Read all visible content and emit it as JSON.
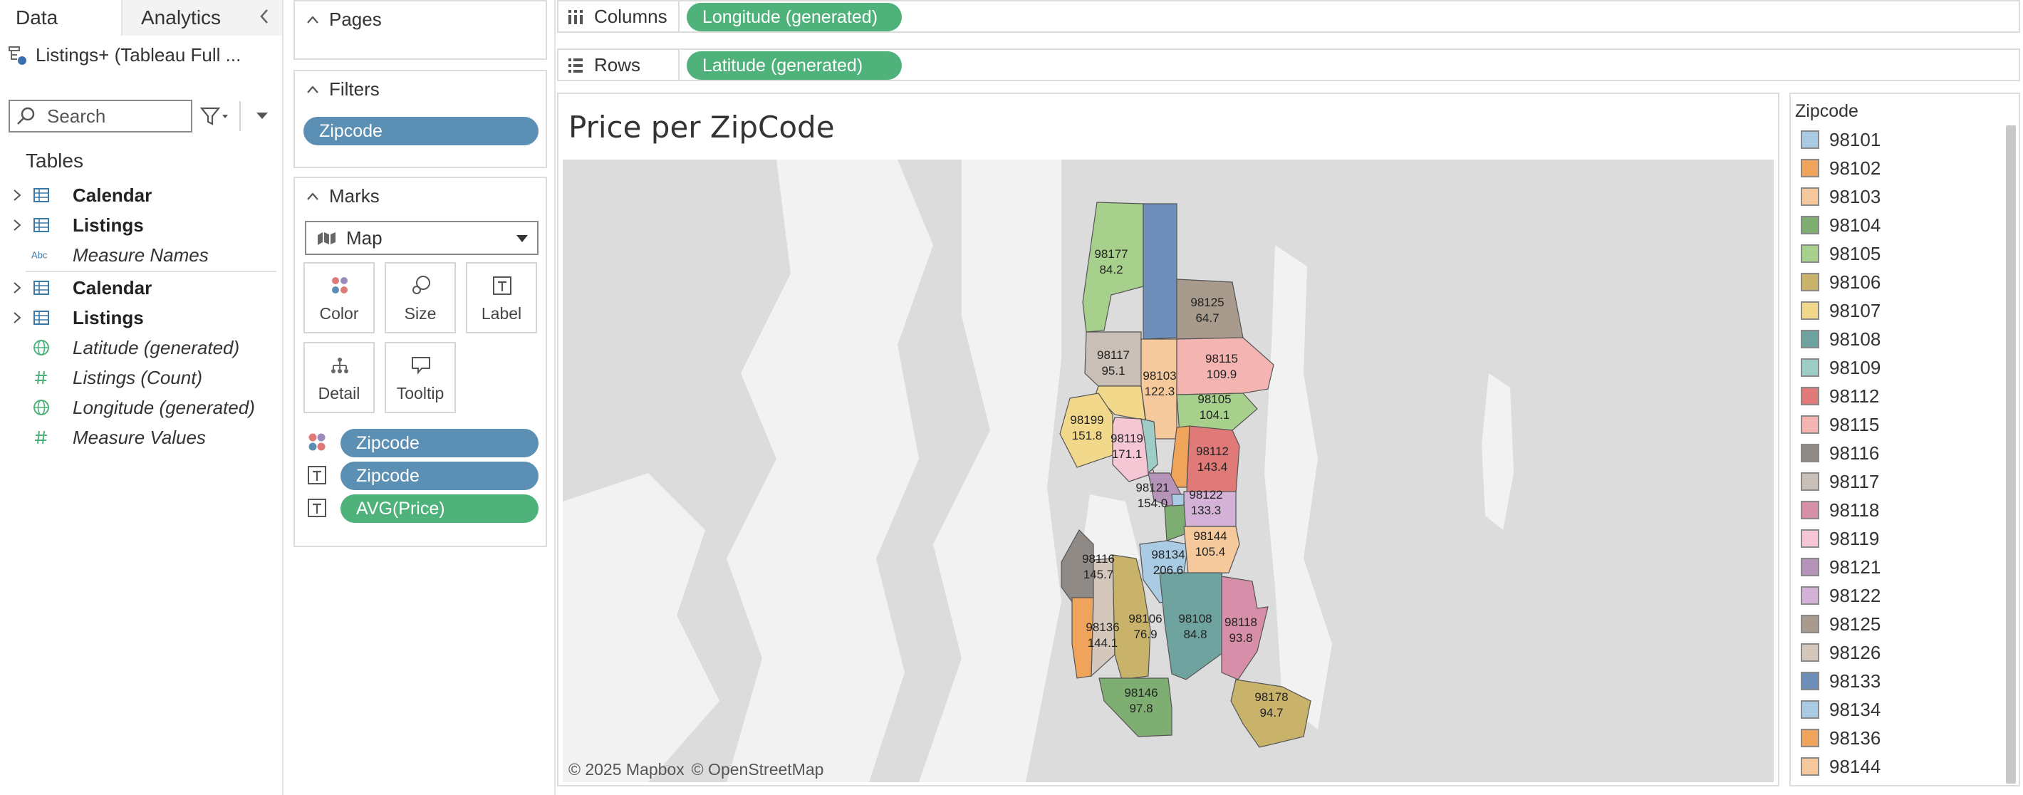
{
  "data_pane": {
    "tabs": [
      {
        "label": "Data",
        "active": true
      },
      {
        "label": "Analytics",
        "active": false
      }
    ],
    "datasource": "Listings+ (Tableau Full ...",
    "search": {
      "placeholder": "Search"
    },
    "tables_header": "Tables",
    "fields": [
      {
        "label": "Calendar",
        "style": "bold",
        "icon": "table-icon",
        "expandable": true
      },
      {
        "label": "Listings",
        "style": "bold",
        "icon": "table-icon",
        "expandable": true
      },
      {
        "label": "Measure Names",
        "style": "italic",
        "icon": "abc-icon",
        "expandable": false
      },
      {
        "label": "Calendar",
        "style": "bold",
        "icon": "table-icon",
        "expandable": true
      },
      {
        "label": "Listings",
        "style": "bold",
        "icon": "table-icon",
        "expandable": true
      },
      {
        "label": "Latitude (generated)",
        "style": "italic",
        "icon": "globe-icon",
        "expandable": false
      },
      {
        "label": "Listings (Count)",
        "style": "italic",
        "icon": "hash-icon",
        "expandable": false
      },
      {
        "label": "Longitude (generated)",
        "style": "italic",
        "icon": "globe-icon",
        "expandable": false
      },
      {
        "label": "Measure Values",
        "style": "italic",
        "icon": "hash-icon",
        "expandable": false
      }
    ]
  },
  "shelves": {
    "pages": {
      "label": "Pages"
    },
    "filters": {
      "label": "Filters",
      "pills": [
        "Zipcode"
      ]
    },
    "marks": {
      "label": "Marks",
      "type": "Map",
      "buttons": [
        "Color",
        "Size",
        "Label",
        "Detail",
        "Tooltip"
      ],
      "pills": [
        {
          "icon": "color-icon",
          "label": "Zipcode",
          "kind": "dimension"
        },
        {
          "icon": "label-icon",
          "label": "Zipcode",
          "kind": "dimension"
        },
        {
          "icon": "label-icon",
          "label": "AVG(Price)",
          "kind": "measure"
        }
      ]
    },
    "columns": {
      "label": "Columns",
      "pill": "Longitude (generated)"
    },
    "rows": {
      "label": "Rows",
      "pill": "Latitude (generated)"
    }
  },
  "viz": {
    "title": "Price per ZipCode",
    "attribution": [
      "© 2025 Mapbox",
      "© OpenStreetMap"
    ],
    "regions": [
      {
        "zip": "98177",
        "value": "84.2",
        "color": "#a8d08d"
      },
      {
        "zip": "98133",
        "value": "",
        "color": "#6f8fbb"
      },
      {
        "zip": "98125",
        "value": "64.7",
        "color": "#a89a8c"
      },
      {
        "zip": "98117",
        "value": "95.1",
        "color": "#c9bfb6"
      },
      {
        "zip": "98103",
        "value": "122.3",
        "color": "#f5c99c"
      },
      {
        "zip": "98115",
        "value": "109.9",
        "color": "#f4b4b2"
      },
      {
        "zip": "98107",
        "value": "",
        "color": "#f2d88a"
      },
      {
        "zip": "98105",
        "value": "104.1",
        "color": "#a8d08d"
      },
      {
        "zip": "98199",
        "value": "151.8",
        "color": "#f2d88a"
      },
      {
        "zip": "98119",
        "value": "171.1",
        "color": "#f5c7d5"
      },
      {
        "zip": "98109",
        "value": "",
        "color": "#9ecdc8"
      },
      {
        "zip": "98102",
        "value": "",
        "color": "#f0a35a"
      },
      {
        "zip": "98112",
        "value": "143.4",
        "color": "#e07a78"
      },
      {
        "zip": "98121",
        "value": "154.0",
        "color": "#b693b8"
      },
      {
        "zip": "98122",
        "value": "133.3",
        "color": "#d4b2d8"
      },
      {
        "zip": "98104",
        "value": "",
        "color": "#7fae72"
      },
      {
        "zip": "98101",
        "value": "",
        "color": "#aacbe4"
      },
      {
        "zip": "98134",
        "value": "206.6",
        "color": "#aacbe4"
      },
      {
        "zip": "98144",
        "value": "105.4",
        "color": "#f5c99c"
      },
      {
        "zip": "98116",
        "value": "145.7",
        "color": "#8f8a86"
      },
      {
        "zip": "98126",
        "value": "",
        "color": "#d4c7bc"
      },
      {
        "zip": "98136",
        "value": "144.1",
        "color": "#f0a35a"
      },
      {
        "zip": "98106",
        "value": "76.9",
        "color": "#c9b36a"
      },
      {
        "zip": "98108",
        "value": "84.8",
        "color": "#6fa3a0"
      },
      {
        "zip": "98118",
        "value": "93.8",
        "color": "#d78ea8"
      },
      {
        "zip": "98146",
        "value": "97.8",
        "color": "#7fae72"
      },
      {
        "zip": "98178",
        "value": "94.7",
        "color": "#c9b36a"
      }
    ]
  },
  "legend": {
    "title": "Zipcode",
    "items": [
      {
        "label": "98101",
        "color": "#aacbe4"
      },
      {
        "label": "98102",
        "color": "#f0a35a"
      },
      {
        "label": "98103",
        "color": "#f5c99c"
      },
      {
        "label": "98104",
        "color": "#7fae72"
      },
      {
        "label": "98105",
        "color": "#a8d08d"
      },
      {
        "label": "98106",
        "color": "#c9b36a"
      },
      {
        "label": "98107",
        "color": "#f2d88a"
      },
      {
        "label": "98108",
        "color": "#6fa3a0"
      },
      {
        "label": "98109",
        "color": "#9ecdc8"
      },
      {
        "label": "98112",
        "color": "#e07a78"
      },
      {
        "label": "98115",
        "color": "#f4b4b2"
      },
      {
        "label": "98116",
        "color": "#8f8a86"
      },
      {
        "label": "98117",
        "color": "#c9bfb6"
      },
      {
        "label": "98118",
        "color": "#d78ea8"
      },
      {
        "label": "98119",
        "color": "#f5c7d5"
      },
      {
        "label": "98121",
        "color": "#b693b8"
      },
      {
        "label": "98122",
        "color": "#d4b2d8"
      },
      {
        "label": "98125",
        "color": "#a89a8c"
      },
      {
        "label": "98126",
        "color": "#d4c7bc"
      },
      {
        "label": "98133",
        "color": "#6f8fbb"
      },
      {
        "label": "98134",
        "color": "#aacbe4"
      },
      {
        "label": "98136",
        "color": "#f0a35a"
      },
      {
        "label": "98144",
        "color": "#f5c99c"
      }
    ]
  },
  "colors": {
    "dimension_pill": "#5b8fb3",
    "measure_pill": "#4fb27a",
    "map_background": "#e4e4e4",
    "map_land": "#d8d8d8",
    "map_water": "#ffffff"
  }
}
